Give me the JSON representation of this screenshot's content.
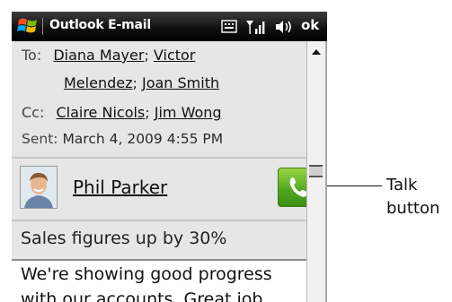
{
  "titlebar": {
    "title": "Outlook E-mail",
    "ok_label": "ok",
    "icons": [
      "windows-start-icon",
      "keyboard-icon",
      "signal-icon",
      "speaker-icon"
    ]
  },
  "message": {
    "to_label": "To:",
    "to": [
      "Diana Mayer",
      "Victor Melendez",
      "Joan Smith"
    ],
    "cc_label": "Cc:",
    "cc": [
      "Claire Nicols",
      "Jim Wong"
    ],
    "sent_label": "Sent:",
    "sent_value": "March 4, 2009 4:55 PM",
    "contact_name": "Phil Parker",
    "subject": "Sales figures up by 30%",
    "body_lines": [
      "We're showing good progress",
      "with our accounts. Great job"
    ]
  },
  "callout": {
    "line1": "Talk",
    "line2": "button"
  },
  "colors": {
    "talk_button": "#4fa51d",
    "header_bg": "#e6e6e6",
    "titlebar_bg": "#000000"
  }
}
